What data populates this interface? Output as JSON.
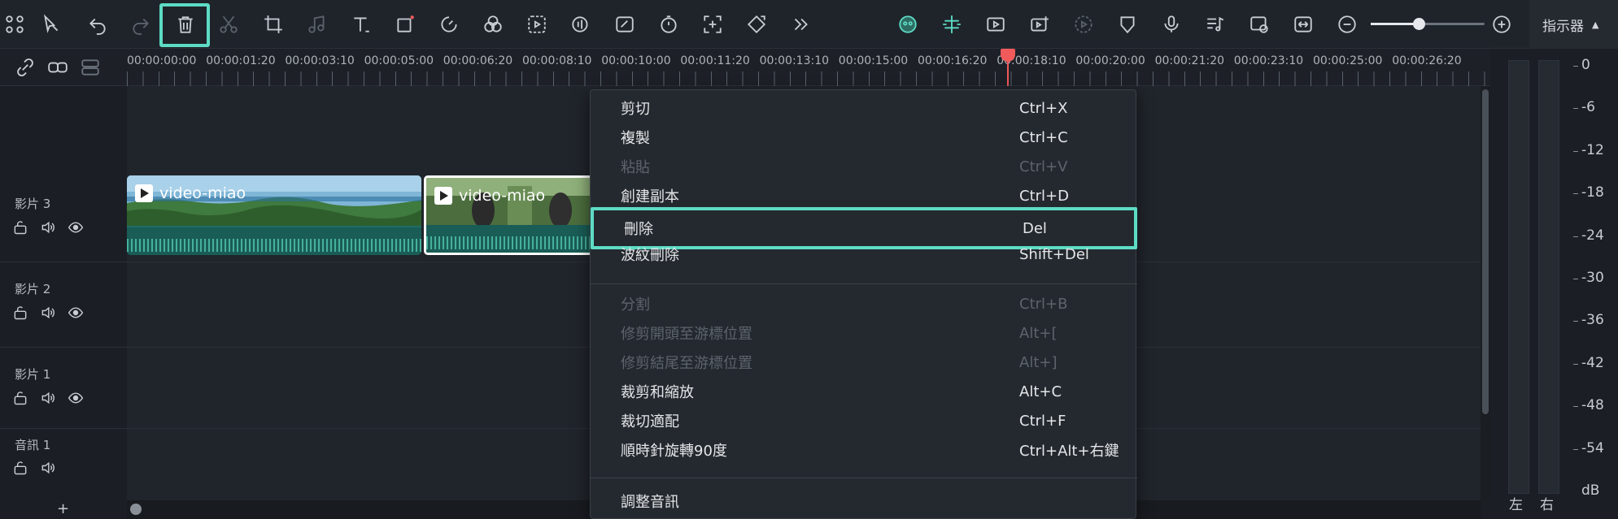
{
  "toolbar": {
    "icons": [
      "grid-icon",
      "select-arrow-icon",
      "undo-icon",
      "redo-icon",
      "delete-icon",
      "scissors-icon",
      "crop-icon",
      "audio-icon",
      "text-icon",
      "shape-icon",
      "speed-icon",
      "color-icon",
      "smart-cutout-icon",
      "ai-audio-icon",
      "ai-edit-icon",
      "timer-icon",
      "add-frame-icon",
      "keyframe-icon",
      "more-icon"
    ],
    "right_icons": [
      "ai-mascot-icon",
      "snap-icon",
      "video-ai-icon",
      "video-plus-icon",
      "play-check-icon",
      "shield-icon",
      "microphone-icon",
      "music-list-icon",
      "preview-icon",
      "fit-icon",
      "zoom-out-icon",
      "zoom-in-icon"
    ],
    "zoom_level": 0.42,
    "indicator_tab": "指示器"
  },
  "ruler": {
    "timecodes": [
      "00:00:00:00",
      "00:00:01:20",
      "00:00:03:10",
      "00:00:05:00",
      "00:00:06:20",
      "00:00:08:10",
      "00:00:10:00",
      "00:00:11:20",
      "00:00:13:10",
      "00:00:15:00",
      "00:00:16:20",
      "00:00:18:10",
      "00:00:20:00",
      "00:00:21:20",
      "00:00:23:10",
      "00:00:25:00",
      "00:00:26:20"
    ]
  },
  "tracks": [
    {
      "label": "影片 3"
    },
    {
      "label": "影片 2"
    },
    {
      "label": "影片 1"
    },
    {
      "label": "音訊 1"
    }
  ],
  "clips": [
    {
      "title": "video-miao"
    },
    {
      "title": "video-miao"
    }
  ],
  "add_track": "+",
  "context_menu": {
    "items": [
      {
        "label": "剪切",
        "shortcut": "Ctrl+X",
        "enabled": true
      },
      {
        "label": "複製",
        "shortcut": "Ctrl+C",
        "enabled": true
      },
      {
        "label": "粘貼",
        "shortcut": "Ctrl+V",
        "enabled": false
      },
      {
        "label": "創建副本",
        "shortcut": "Ctrl+D",
        "enabled": true
      },
      {
        "label": "刪除",
        "shortcut": "Del",
        "enabled": true,
        "highlighted": true
      },
      {
        "label": "波紋刪除",
        "shortcut": "Shift+Del",
        "enabled": true
      },
      {
        "label": "分割",
        "shortcut": "Ctrl+B",
        "enabled": false
      },
      {
        "label": "修剪開頭至游標位置",
        "shortcut": "Alt+[",
        "enabled": false
      },
      {
        "label": "修剪結尾至游標位置",
        "shortcut": "Alt+]",
        "enabled": false
      },
      {
        "label": "裁剪和縮放",
        "shortcut": "Alt+C",
        "enabled": true
      },
      {
        "label": "裁切適配",
        "shortcut": "Ctrl+F",
        "enabled": true
      },
      {
        "label": "順時針旋轉90度",
        "shortcut": "Ctrl+Alt+右鍵",
        "enabled": true
      },
      {
        "label": "調整音訊",
        "shortcut": "",
        "enabled": true
      }
    ]
  },
  "meter": {
    "scale": [
      "0",
      "-6",
      "-12",
      "-18",
      "-24",
      "-30",
      "-36",
      "-42",
      "-48",
      "-54",
      "dB"
    ],
    "left": "左",
    "right": "右"
  },
  "colors": {
    "accent": "#5ddcc4",
    "playhead": "#f05a5a",
    "background": "#1b1f25"
  }
}
